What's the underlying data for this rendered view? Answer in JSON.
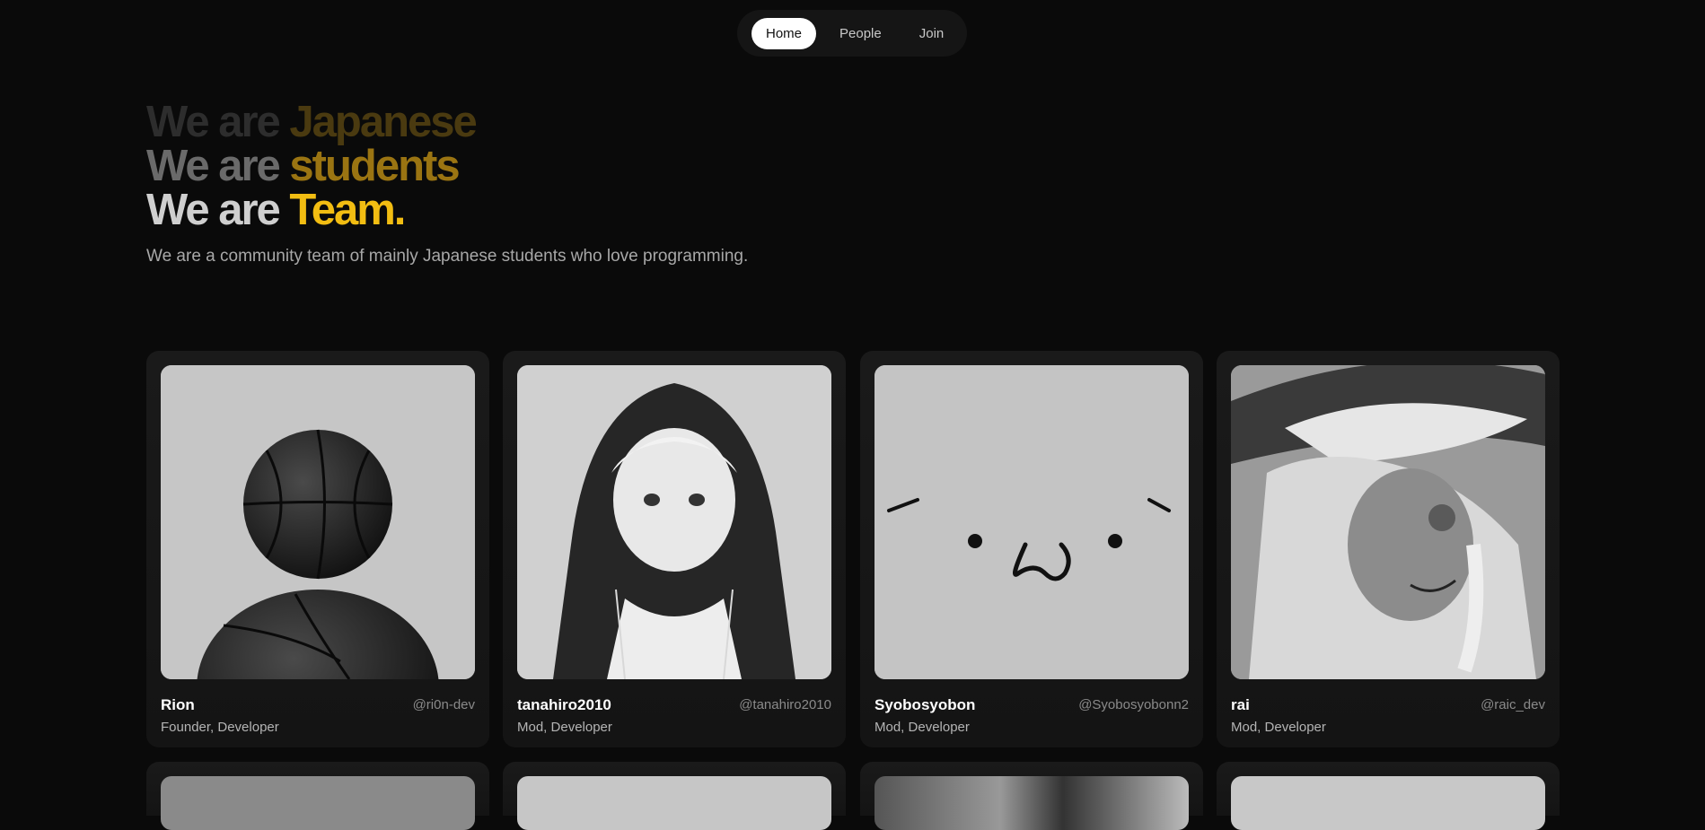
{
  "nav": {
    "items": [
      {
        "label": "Home",
        "active": true
      },
      {
        "label": "People",
        "active": false
      },
      {
        "label": "Join",
        "active": false
      }
    ]
  },
  "hero": {
    "line1": {
      "prefix": "We are ",
      "highlight": "Japanese"
    },
    "line2": {
      "prefix": "We are ",
      "highlight": "students"
    },
    "line3": {
      "prefix": "We are ",
      "highlight": "Team."
    },
    "subtitle": "We are a community team of mainly Japanese students who love programming.",
    "accent_color": "#f2bd12"
  },
  "members": [
    {
      "name": "Rion",
      "handle": "@ri0n-dev",
      "role": "Founder, Developer",
      "avatar": "basketball-image"
    },
    {
      "name": "tanahiro2010",
      "handle": "@tanahiro2010",
      "role": "Mod, Developer",
      "avatar": "anime-hoodie-boy-image"
    },
    {
      "name": "Syobosyobon",
      "handle": "@Syobosyobonn2",
      "role": "Mod, Developer",
      "avatar": "kaomoji-face-image"
    },
    {
      "name": "rai",
      "handle": "@raic_dev",
      "role": "Mod, Developer",
      "avatar": "anime-witch-girl-image"
    }
  ]
}
